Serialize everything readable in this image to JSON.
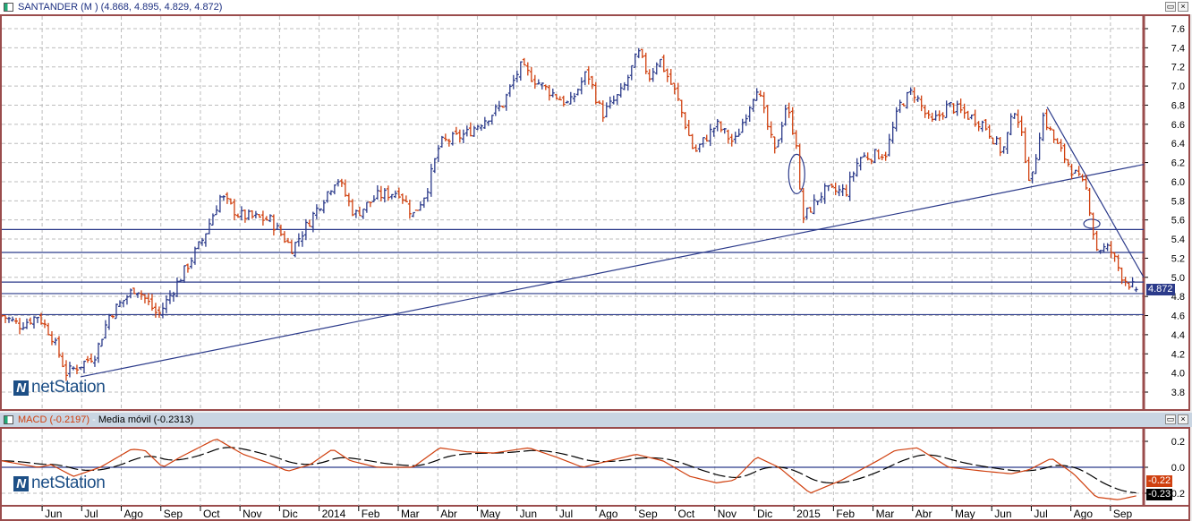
{
  "main": {
    "title": "SANTANDER (M ) (4.868, 4.895, 4.829, 4.872)",
    "last_price": "4.872",
    "logo": "netStation"
  },
  "macd": {
    "title_macd": "MACD (-0.2197)",
    "title_sep": " - ",
    "title_signal": "Media móvil (-0.2313)",
    "macd_tag": "-0.22",
    "signal_tag": "-0.23",
    "logo": "netStation"
  },
  "buttons": {
    "restore": "▭",
    "close": "×"
  },
  "colors": {
    "up": "#2b3a8a",
    "down": "#d0400f",
    "line": "#2b3a8a",
    "macd": "#d0400f",
    "signal": "#000000",
    "grid": "#bdbdbd",
    "frame": "#9a4c4c"
  },
  "chart_data": [
    {
      "type": "ohlc",
      "title": "SANTANDER (M )",
      "last": {
        "open": 4.868,
        "high": 4.895,
        "low": 4.829,
        "close": 4.872
      },
      "x_unit": "months since Jun 2013",
      "xlim": [
        -1.02,
        27.84
      ],
      "ylim": [
        3.7,
        7.7
      ],
      "y_ticks": [
        "7.6",
        "7.4",
        "7.2",
        "7.0",
        "6.8",
        "6.6",
        "6.4",
        "6.2",
        "6.0",
        "5.8",
        "5.6",
        "5.4",
        "5.2",
        "5.0",
        "4.8",
        "4.6",
        "4.4",
        "4.2",
        "4.0",
        "3.8"
      ],
      "x_ticks": [
        {
          "m": 0,
          "label": "Jun"
        },
        {
          "m": 1,
          "label": "Jul"
        },
        {
          "m": 2,
          "label": "Ago"
        },
        {
          "m": 3,
          "label": "Sep"
        },
        {
          "m": 4,
          "label": "Oct"
        },
        {
          "m": 5,
          "label": "Nov"
        },
        {
          "m": 6,
          "label": "Dic"
        },
        {
          "m": 7,
          "label": "2014"
        },
        {
          "m": 8,
          "label": "Feb"
        },
        {
          "m": 9,
          "label": "Mar"
        },
        {
          "m": 10,
          "label": "Abr"
        },
        {
          "m": 11,
          "label": "May"
        },
        {
          "m": 12,
          "label": "Jun"
        },
        {
          "m": 13,
          "label": "Jul"
        },
        {
          "m": 14,
          "label": "Ago"
        },
        {
          "m": 15,
          "label": "Sep"
        },
        {
          "m": 16,
          "label": "Oct"
        },
        {
          "m": 17,
          "label": "Nov"
        },
        {
          "m": 18,
          "label": "Dic"
        },
        {
          "m": 19,
          "label": "2015"
        },
        {
          "m": 20,
          "label": "Feb"
        },
        {
          "m": 21,
          "label": "Mar"
        },
        {
          "m": 22,
          "label": "Abr"
        },
        {
          "m": 23,
          "label": "May"
        },
        {
          "m": 24,
          "label": "Jun"
        },
        {
          "m": 25,
          "label": "Jul"
        },
        {
          "m": 26,
          "label": "Ago"
        },
        {
          "m": 27,
          "label": "Sep"
        }
      ],
      "close_keypoints": [
        [
          -1.02,
          4.6
        ],
        [
          -0.56,
          4.5
        ],
        [
          -0.11,
          4.6
        ],
        [
          0.23,
          4.4
        ],
        [
          0.61,
          4.0
        ],
        [
          1.02,
          4.1
        ],
        [
          1.35,
          4.2
        ],
        [
          1.69,
          4.6
        ],
        [
          2.37,
          4.9
        ],
        [
          2.93,
          4.6
        ],
        [
          3.5,
          5.0
        ],
        [
          4.06,
          5.4
        ],
        [
          4.51,
          5.85
        ],
        [
          4.97,
          5.65
        ],
        [
          5.76,
          5.6
        ],
        [
          6.32,
          5.3
        ],
        [
          6.77,
          5.6
        ],
        [
          7.45,
          6.05
        ],
        [
          7.9,
          5.65
        ],
        [
          8.47,
          5.85
        ],
        [
          9.03,
          5.9
        ],
        [
          9.37,
          5.65
        ],
        [
          9.71,
          5.9
        ],
        [
          10.05,
          6.4
        ],
        [
          10.72,
          6.5
        ],
        [
          11.63,
          6.8
        ],
        [
          12.08,
          7.2
        ],
        [
          12.64,
          7.0
        ],
        [
          13.32,
          6.8
        ],
        [
          13.77,
          7.15
        ],
        [
          14.15,
          6.7
        ],
        [
          14.67,
          6.95
        ],
        [
          15.06,
          7.35
        ],
        [
          15.35,
          7.1
        ],
        [
          15.58,
          7.3
        ],
        [
          16.03,
          6.9
        ],
        [
          16.48,
          6.3
        ],
        [
          17.04,
          6.6
        ],
        [
          17.49,
          6.4
        ],
        [
          18.06,
          7.0
        ],
        [
          18.51,
          6.3
        ],
        [
          18.8,
          6.8
        ],
        [
          19.07,
          6.4
        ],
        [
          19.19,
          5.6
        ],
        [
          19.75,
          5.9
        ],
        [
          20.32,
          5.9
        ],
        [
          20.65,
          6.25
        ],
        [
          21.33,
          6.3
        ],
        [
          21.67,
          6.8
        ],
        [
          22.01,
          6.95
        ],
        [
          22.46,
          6.6
        ],
        [
          22.91,
          6.8
        ],
        [
          23.36,
          6.7
        ],
        [
          23.81,
          6.6
        ],
        [
          24.27,
          6.3
        ],
        [
          24.6,
          6.8
        ],
        [
          24.99,
          5.95
        ],
        [
          25.28,
          6.7
        ],
        [
          25.62,
          6.4
        ],
        [
          26.07,
          6.1
        ],
        [
          26.41,
          5.9
        ],
        [
          26.63,
          5.3
        ],
        [
          26.98,
          5.3
        ],
        [
          27.31,
          5.0
        ],
        [
          27.65,
          4.87
        ]
      ],
      "horizontal_lines": [
        5.5,
        5.26,
        4.95,
        4.83,
        4.61
      ],
      "trendlines": [
        [
          [
            0.97,
            3.96
          ],
          [
            27.84,
            6.18
          ]
        ],
        [
          [
            25.4,
            6.78
          ],
          [
            27.84,
            5.0
          ]
        ]
      ],
      "ellipses": [
        {
          "m": 19.07,
          "price": 6.08
        },
        {
          "m": 26.53,
          "price": 5.56
        }
      ]
    },
    {
      "type": "line",
      "title": "MACD",
      "ylim": [
        -0.25,
        0.29
      ],
      "y_ticks": [
        "0.2",
        "0.0",
        "-0.2"
      ],
      "zero_line": 0,
      "series": [
        {
          "name": "MACD (-0.2197)",
          "last": -0.2197,
          "keypoints": [
            [
              -1.02,
              0.05
            ],
            [
              -0.11,
              0.0
            ],
            [
              0.23,
              0.02
            ],
            [
              0.79,
              -0.07
            ],
            [
              1.47,
              0.0
            ],
            [
              2.26,
              0.14
            ],
            [
              2.6,
              0.13
            ],
            [
              3.05,
              0.0
            ],
            [
              3.5,
              0.08
            ],
            [
              4.4,
              0.22
            ],
            [
              5.08,
              0.1
            ],
            [
              5.76,
              0.03
            ],
            [
              6.21,
              -0.03
            ],
            [
              6.77,
              0.02
            ],
            [
              7.34,
              0.14
            ],
            [
              7.79,
              0.05
            ],
            [
              8.47,
              0.0
            ],
            [
              9.37,
              0.0
            ],
            [
              10.05,
              0.15
            ],
            [
              10.72,
              0.12
            ],
            [
              11.4,
              0.11
            ],
            [
              12.3,
              0.15
            ],
            [
              12.98,
              0.08
            ],
            [
              13.66,
              0.0
            ],
            [
              14.33,
              0.05
            ],
            [
              15.01,
              0.1
            ],
            [
              15.69,
              0.05
            ],
            [
              16.37,
              -0.07
            ],
            [
              17.04,
              -0.12
            ],
            [
              17.49,
              -0.1
            ],
            [
              18.06,
              0.08
            ],
            [
              18.62,
              0.0
            ],
            [
              19.41,
              -0.2
            ],
            [
              20.2,
              -0.1
            ],
            [
              21.11,
              0.05
            ],
            [
              21.56,
              0.13
            ],
            [
              22.12,
              0.15
            ],
            [
              22.91,
              0.0
            ],
            [
              23.81,
              -0.03
            ],
            [
              24.49,
              -0.05
            ],
            [
              24.94,
              -0.02
            ],
            [
              25.51,
              0.07
            ],
            [
              26.07,
              -0.05
            ],
            [
              26.64,
              -0.23
            ],
            [
              27.2,
              -0.25
            ],
            [
              27.65,
              -0.22
            ]
          ]
        },
        {
          "name": "Media móvil (-0.2313)",
          "last": -0.2313
        }
      ]
    }
  ]
}
